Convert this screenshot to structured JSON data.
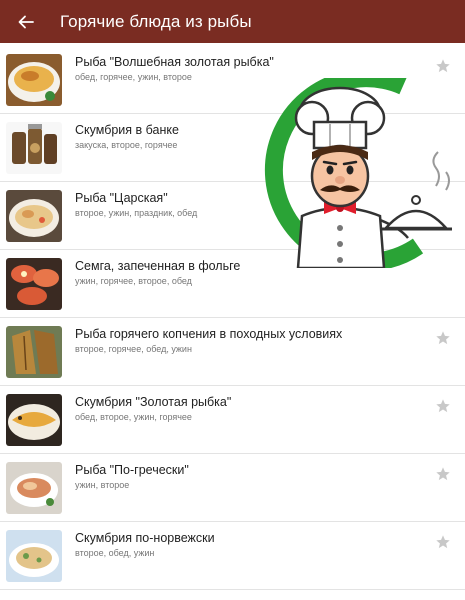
{
  "header": {
    "title": "Горячие блюда из рыбы"
  },
  "recipes": [
    {
      "title": "Рыба \"Волшебная золотая рыбка\"",
      "tags": "обед, горячее, ужин, второе"
    },
    {
      "title": "Скумбрия в банке",
      "tags": "закуска, второе, горячее"
    },
    {
      "title": "Рыба \"Царская\"",
      "tags": "второе, ужин, праздник, обед"
    },
    {
      "title": "Семга, запеченная в фольге",
      "tags": "ужин, горячее, второе, обед"
    },
    {
      "title": "Рыба горячего копчения в походных условиях",
      "tags": "второе, горячее, обед, ужин"
    },
    {
      "title": "Скумбрия \"Золотая рыбка\"",
      "tags": "обед, второе, ужин, горячее"
    },
    {
      "title": "Рыба \"По-гречески\"",
      "tags": "ужин, второе"
    },
    {
      "title": "Скумбрия по-норвежски",
      "tags": "второе, обед, ужин"
    }
  ],
  "colors": {
    "appbar": "#7a2c22",
    "ring": "#2aa336",
    "star": "#c8c8c8"
  }
}
